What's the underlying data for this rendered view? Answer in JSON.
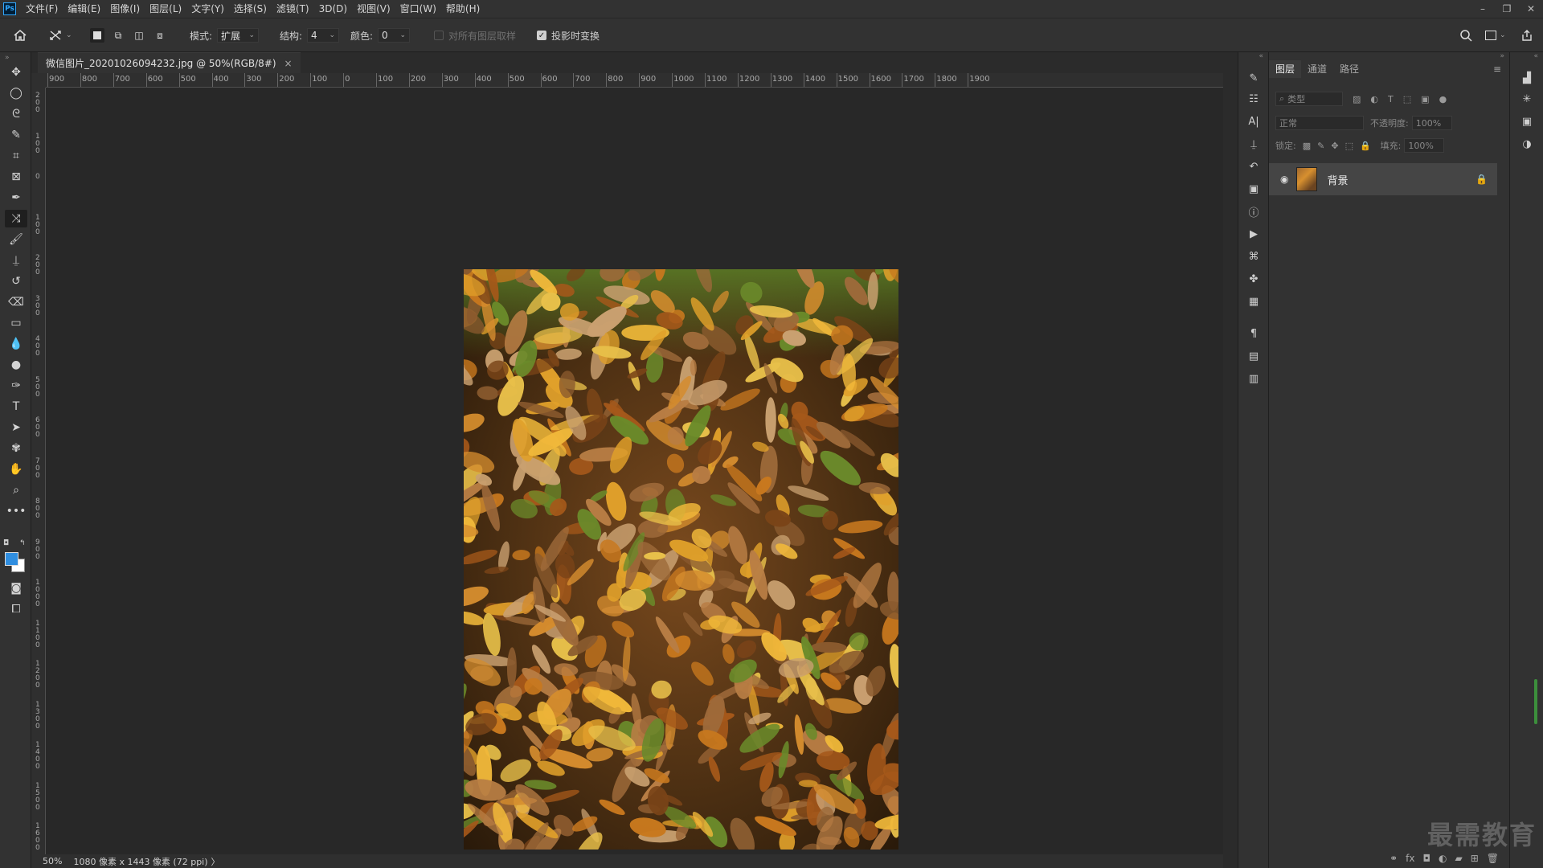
{
  "app": {
    "logo": "Ps"
  },
  "menu": [
    "文件(F)",
    "编辑(E)",
    "图像(I)",
    "图层(L)",
    "文字(Y)",
    "选择(S)",
    "滤镜(T)",
    "3D(D)",
    "视图(V)",
    "窗口(W)",
    "帮助(H)"
  ],
  "window_controls": {
    "minimize": "–",
    "restore": "❐",
    "close": "✕"
  },
  "options": {
    "mode_label": "模式:",
    "mode_value": "扩展",
    "structure_label": "结构:",
    "structure_value": "4",
    "color_label": "颜色:",
    "color_value": "0",
    "sample_all_layers": "对所有图层取样",
    "sample_all_layers_checked": false,
    "transform_on_drop": "投影时变换",
    "transform_on_drop_checked": true
  },
  "document": {
    "tab_title": "微信图片_20201026094232.jpg @ 50%(RGB/8#)",
    "close": "×"
  },
  "ruler": {
    "h_labels": [
      "900",
      "800",
      "700",
      "600",
      "500",
      "400",
      "300",
      "200",
      "100",
      "0",
      "100",
      "200",
      "300",
      "400",
      "500",
      "600",
      "700",
      "800",
      "900",
      "1000",
      "1100",
      "1200",
      "1300",
      "1400",
      "1500",
      "1600",
      "1700",
      "1800",
      "1900"
    ],
    "v_labels": [
      "2\n0\n0",
      "1\n0\n0",
      "0",
      "1\n0\n0",
      "2\n0\n0",
      "3\n0\n0",
      "4\n0\n0",
      "5\n0\n0",
      "6\n0\n0",
      "7\n0\n0",
      "8\n0\n0",
      "9\n0\n0",
      "1\n0\n0\n0",
      "1\n1\n0\n0",
      "1\n2\n0\n0",
      "1\n3\n0\n0",
      "1\n4\n0\n0",
      "1\n5\n0\n0",
      "1\n6\n0\n0"
    ]
  },
  "status": {
    "zoom": "50%",
    "info": "1080 像素 x 1443 像素 (72 ppi)",
    "more": "〉"
  },
  "layers_panel": {
    "tabs": [
      "图层",
      "通道",
      "路径"
    ],
    "active_tab": 0,
    "filter_placeholder": "类型",
    "blend_mode": "正常",
    "opacity_label": "不透明度:",
    "opacity_value": "100%",
    "lock_label": "锁定:",
    "fill_label": "填充:",
    "fill_value": "100%",
    "layer_name": "背景"
  },
  "watermark": "最需教育",
  "colors": {
    "foreground": "#2f8ee0",
    "background": "#ffffff"
  }
}
